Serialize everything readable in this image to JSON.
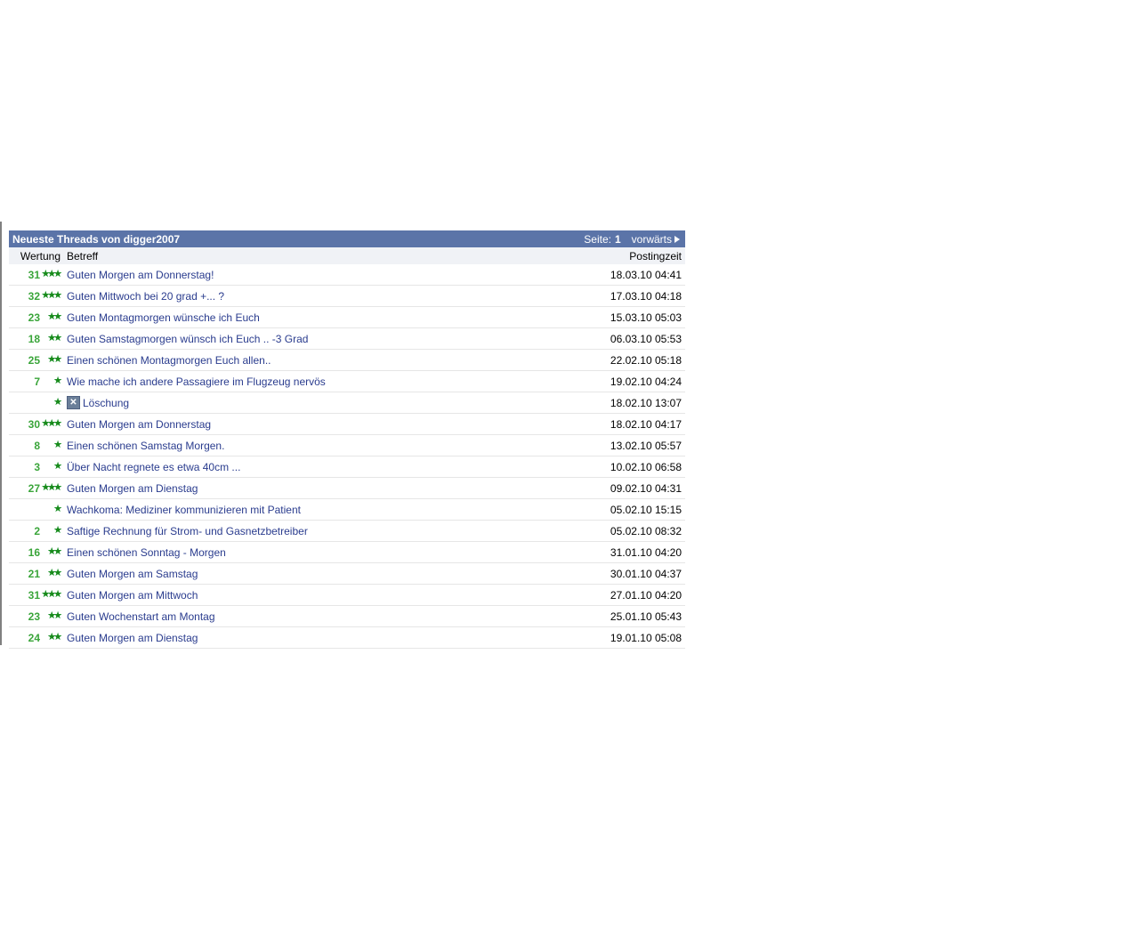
{
  "header": {
    "title": "Neueste Threads von digger2007",
    "page_label": "Seite:",
    "page_value": "1",
    "next_label": "vorwärts"
  },
  "columns": {
    "rating": "Wertung",
    "subject": "Betreff",
    "time": "Postingzeit"
  },
  "threads": [
    {
      "score": "31",
      "stars": 3,
      "subject": "Guten Morgen am Donnerstag!",
      "time": "18.03.10 04:41"
    },
    {
      "score": "32",
      "stars": 3,
      "subject": "Guten Mittwoch bei 20 grad +... ?",
      "time": "17.03.10 04:18"
    },
    {
      "score": "23",
      "stars": 2,
      "subject": "Guten Montagmorgen wünsche ich Euch",
      "time": "15.03.10 05:03"
    },
    {
      "score": "18",
      "stars": 2,
      "subject": "Guten Samstagmorgen wünsch ich Euch .. -3 Grad",
      "time": "06.03.10 05:53"
    },
    {
      "score": "25",
      "stars": 2,
      "subject": "Einen schönen Montagmorgen Euch allen..",
      "time": "22.02.10 05:18"
    },
    {
      "score": "7",
      "stars": 1,
      "subject": "Wie mache ich andere Passagiere im Flugzeug nervös",
      "time": "19.02.10 04:24"
    },
    {
      "score": "",
      "stars": 1,
      "subject": "Löschung",
      "time": "18.02.10 13:07",
      "deleted": true
    },
    {
      "score": "30",
      "stars": 3,
      "subject": "Guten Morgen am Donnerstag",
      "time": "18.02.10 04:17"
    },
    {
      "score": "8",
      "stars": 1,
      "subject": "Einen schönen Samstag Morgen.",
      "time": "13.02.10 05:57"
    },
    {
      "score": "3",
      "stars": 1,
      "subject": "Über Nacht regnete es etwa 40cm ...",
      "time": "10.02.10 06:58"
    },
    {
      "score": "27",
      "stars": 3,
      "subject": "Guten Morgen am Dienstag",
      "time": "09.02.10 04:31"
    },
    {
      "score": "",
      "stars": 1,
      "subject": "Wachkoma: Mediziner kommunizieren mit Patient",
      "time": "05.02.10 15:15"
    },
    {
      "score": "2",
      "stars": 1,
      "subject": "Saftige Rechnung für Strom- und Gasnetzbetreiber",
      "time": "05.02.10 08:32"
    },
    {
      "score": "16",
      "stars": 2,
      "subject": "Einen schönen Sonntag - Morgen",
      "time": "31.01.10 04:20"
    },
    {
      "score": "21",
      "stars": 2,
      "subject": "Guten Morgen am Samstag",
      "time": "30.01.10 04:37"
    },
    {
      "score": "31",
      "stars": 3,
      "subject": "Guten Morgen am Mittwoch",
      "time": "27.01.10 04:20"
    },
    {
      "score": "23",
      "stars": 2,
      "subject": "Guten Wochenstart am Montag",
      "time": "25.01.10 05:43"
    },
    {
      "score": "24",
      "stars": 2,
      "subject": "Guten Morgen am Dienstag",
      "time": "19.01.10 05:08"
    }
  ],
  "icons": {
    "star": "star-icon",
    "deleted": "delete-x-icon",
    "next": "arrow-right-icon"
  },
  "colors": {
    "header_bg": "#5b74a8",
    "score": "#3aa53a",
    "link": "#2a3c8e",
    "star": "#1a8a1a"
  }
}
